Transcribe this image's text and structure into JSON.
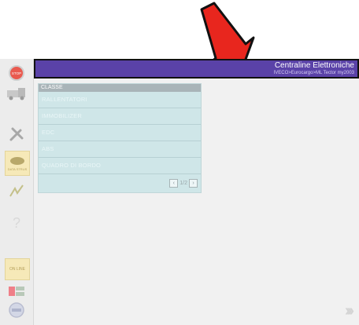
{
  "header": {
    "title": "Centraline Elettroniche",
    "subtitle": "IVECO>Eurocargo>ML Tector my2003"
  },
  "sidebar": {
    "stop_label": "STOP",
    "data_label": "DATA STRUS",
    "online_label": "ON LINE"
  },
  "panel": {
    "header": "CLASSE",
    "items": [
      "RALLENTATORI",
      "IMMOBILIZER",
      "EDC",
      "ABS",
      "QUADRO DI BORDO"
    ],
    "pager": "1/2"
  },
  "colors": {
    "title_bar": "#5a42a8",
    "panel_bg": "#cfe6e8",
    "annotation_arrow": "#e8261e"
  }
}
